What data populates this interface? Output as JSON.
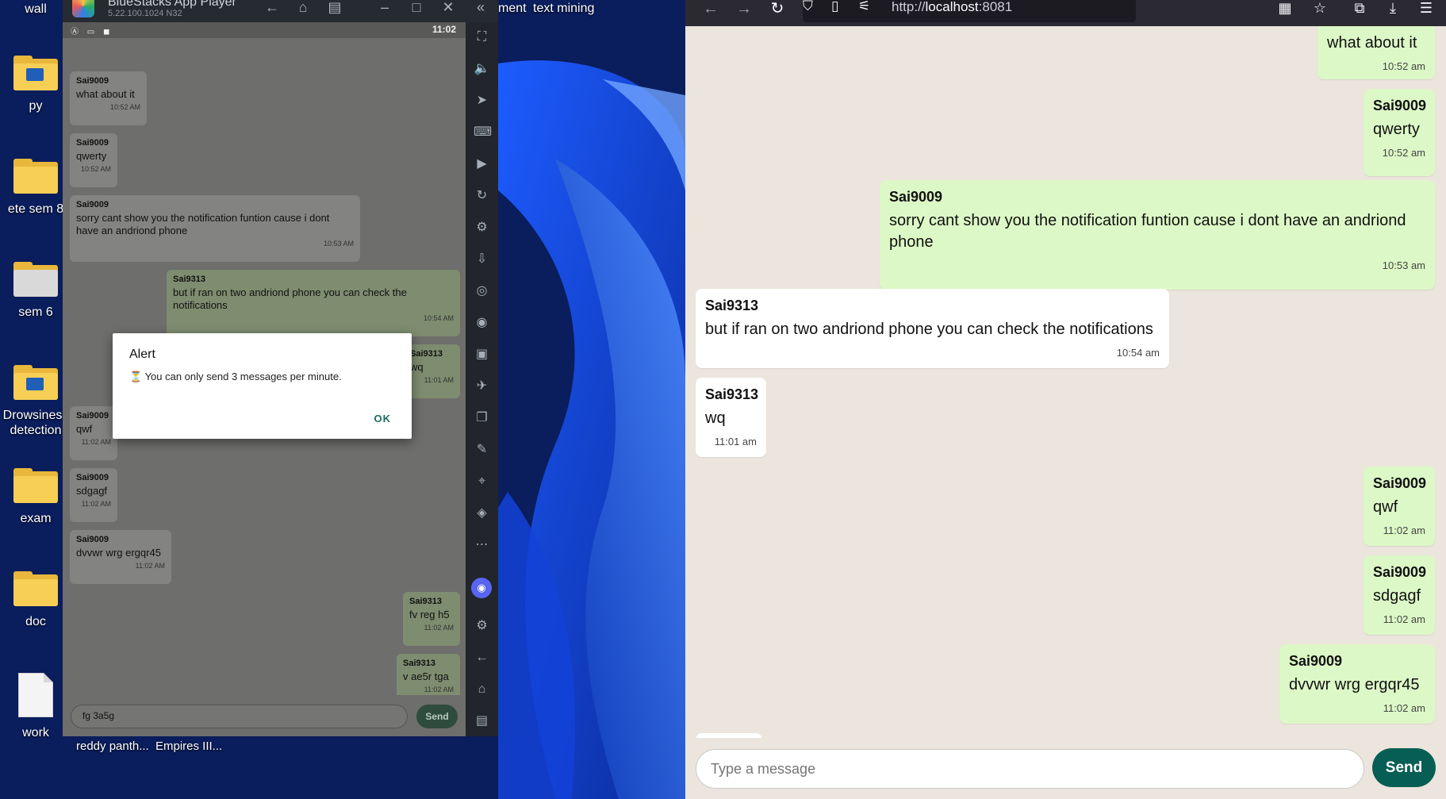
{
  "desktop": {
    "icons": [
      {
        "label": "wall"
      },
      {
        "label": "py"
      },
      {
        "label": "ete sem 8"
      },
      {
        "label": "sem 6"
      },
      {
        "label": "Drowsiness detection"
      },
      {
        "label": "exam"
      },
      {
        "label": "doc"
      },
      {
        "label": "work"
      }
    ],
    "top_labels": [
      "ment",
      "text mining"
    ],
    "bottom_labels": [
      "reddy panth...",
      "Empires III..."
    ]
  },
  "bluestacks": {
    "title": "BlueStacks App Player",
    "version": "5.22.100.1024  N32",
    "status_time": "11:02",
    "messages": [
      {
        "sender": "Sai9009",
        "text": "what about it",
        "time": "10:52 AM",
        "mine": false
      },
      {
        "sender": "Sai9009",
        "text": "qwerty",
        "time": "10:52 AM",
        "mine": false
      },
      {
        "sender": "Sai9009",
        "text": "sorry cant show you the notification funtion cause i dont have an andriond phone",
        "time": "10:53 AM",
        "mine": false
      },
      {
        "sender": "Sai9313",
        "text": "but if ran on two andriond phone you can check the notifications",
        "time": "10:54 AM",
        "mine": true
      },
      {
        "sender": "Sai9313",
        "text": "wq",
        "time": "11:01 AM",
        "mine": true
      },
      {
        "sender": "Sai9009",
        "text": "qwf",
        "time": "11:02 AM",
        "mine": false
      },
      {
        "sender": "Sai9009",
        "text": "sdgagf",
        "time": "11:02 AM",
        "mine": false
      },
      {
        "sender": "Sai9009",
        "text": "dvvwr wrg ergqr45",
        "time": "11:02 AM",
        "mine": false
      },
      {
        "sender": "Sai9313",
        "text": "fv reg h5",
        "time": "11:02 AM",
        "mine": true
      },
      {
        "sender": "Sai9313",
        "text": "v ae5r tga",
        "time": "11:02 AM",
        "mine": true
      }
    ],
    "input_value": "fg 3a5g",
    "send_label": "Send",
    "alert": {
      "title": "Alert",
      "message": "⏳ You can only send 3 messages per minute.",
      "ok_label": "OK"
    }
  },
  "firefox": {
    "url_scheme": "http://",
    "url_host": "localhost",
    "url_port": ":8081",
    "messages": [
      {
        "sender": "",
        "text": "what about it",
        "time": "10:52 am",
        "mine": true
      },
      {
        "sender": "Sai9009",
        "text": "qwerty",
        "time": "10:52 am",
        "mine": true
      },
      {
        "sender": "Sai9009",
        "text": "sorry cant show you the notification funtion cause i dont have an andriond phone",
        "time": "10:53 am",
        "mine": true
      },
      {
        "sender": "Sai9313",
        "text": "but if ran on two andriond phone you can check the notifications",
        "time": "10:54 am",
        "mine": false
      },
      {
        "sender": "Sai9313",
        "text": "wq",
        "time": "11:01 am",
        "mine": false
      },
      {
        "sender": "Sai9009",
        "text": "qwf",
        "time": "11:02 am",
        "mine": true
      },
      {
        "sender": "Sai9009",
        "text": "sdgagf",
        "time": "11:02 am",
        "mine": true
      },
      {
        "sender": "Sai9009",
        "text": "dvvwr wrg ergqr45",
        "time": "11:02 am",
        "mine": true
      }
    ],
    "input_placeholder": "Type a message",
    "send_label": "Send"
  },
  "colors": {
    "whatsapp_green": "#075e54",
    "bubble_mine": "#dcf8c6",
    "chat_bg": "#ece5dd",
    "alert_ok": "#1a6b5f",
    "firefox_toolbar": "#2b2a33"
  }
}
